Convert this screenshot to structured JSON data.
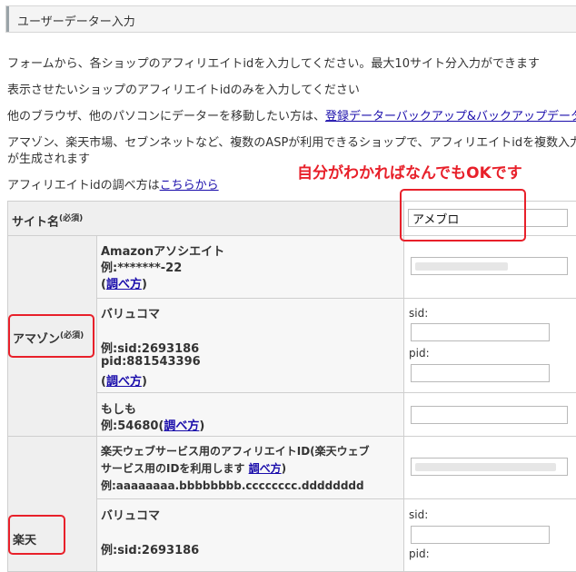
{
  "header": {
    "title": "ユーザーデーター入力"
  },
  "intro": {
    "line1": "フォームから、各ショップのアフィリエイトidを入力してください。最大10サイト分入力ができます",
    "line2": "表示させたいショップのアフィリエイトidのみを入力してください",
    "line3_text": "他のブラウザ、他のパソコンにデーターを移動したい方は、",
    "line3_link": "登録データーバックアップ&バックアップデータ",
    "line4": "アマゾン、楽天市場、セブンネットなど、複数のASPが利用できるショップで、アフィリエイトidを複数入力",
    "line5": "が生成されます",
    "line6_text": "アフィリエイトidの調べ方は",
    "line6_link": "こちらから"
  },
  "annotation": "自分がわかればなんでもOKです",
  "form": {
    "site_name": {
      "label": "サイト名",
      "required": "(必須)",
      "value": "アメブロ"
    },
    "amazon": {
      "label": "アマゾン",
      "required": "(必須)",
      "associate": {
        "title": "Amazonアソシエイト",
        "example": "例:*******-22",
        "howto": "調べ方"
      },
      "valuecommerce": {
        "title": "バリュコマ",
        "ex_sid": "例:sid:2693186",
        "ex_pid": "pid:881543396",
        "howto": "調べ方",
        "sid_label": "sid:",
        "pid_label": "pid:"
      },
      "moshimo": {
        "title": "もしも",
        "example": "例:54680(",
        "howto": "調べ方",
        "close": ")"
      }
    },
    "rakuten": {
      "label": "楽天",
      "webservice": {
        "title_line1": "楽天ウェブサービス用のアフィリエイトID(楽天ウェブ",
        "title_line2": "サービス用のIDを利用します ",
        "howto": "調べ方",
        "close": ")",
        "example": "例:aaaaaaaa.bbbbbbbb.cccccccc.dddddddd"
      },
      "valuecommerce": {
        "title": "バリュコマ",
        "ex_sid": "例:sid:2693186",
        "sid_label": "sid:",
        "pid_label": "pid:"
      }
    }
  }
}
